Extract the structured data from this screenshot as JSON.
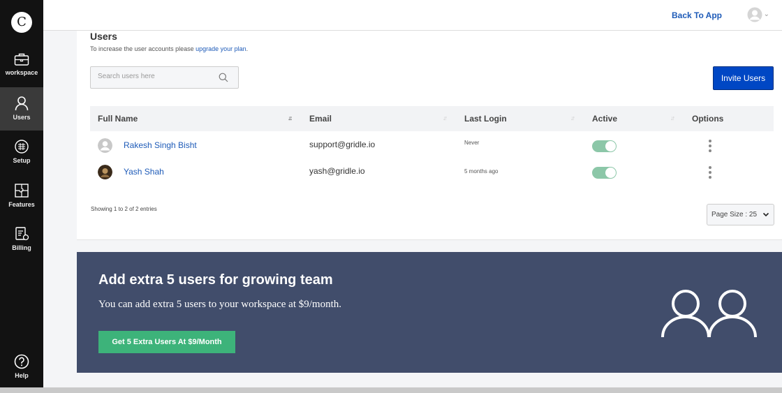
{
  "app": {
    "logo_letter": "C"
  },
  "sidebar": {
    "items": [
      {
        "label": "workspace",
        "icon": "briefcase-icon"
      },
      {
        "label": "Users",
        "icon": "user-icon",
        "active": true
      },
      {
        "label": "Setup",
        "icon": "settings-sheet-icon"
      },
      {
        "label": "Features",
        "icon": "puzzle-icon"
      },
      {
        "label": "Billing",
        "icon": "billing-icon"
      }
    ],
    "help_label": "Help"
  },
  "header": {
    "back_label": "Back To App"
  },
  "users": {
    "title": "Users",
    "subtitle_text": "To increase the user accounts please ",
    "subtitle_link": "upgrade your plan",
    "subtitle_end": ".",
    "search_placeholder": "Search users here",
    "invite_label": "Invite Users",
    "columns": [
      "Full Name",
      "Email",
      "Last Login",
      "Active",
      "Options"
    ],
    "rows": [
      {
        "name": "Rakesh Singh Bisht",
        "email": "support@gridle.io",
        "last_login": "Never",
        "active": true
      },
      {
        "name": "Yash Shah",
        "email": "yash@gridle.io",
        "last_login": "5 months ago",
        "active": true
      }
    ],
    "showing": "Showing 1 to 2 of 2 entries",
    "page_size": "Page Size : 25"
  },
  "promo": {
    "title": "Add extra 5 users for growing team",
    "text": "You can add extra 5 users to your workspace at $9/month.",
    "button": "Get 5 Extra Users At $9/Month"
  },
  "colors": {
    "primary": "#0047c4",
    "link": "#1e5bb8",
    "banner": "#414d6b",
    "cta": "#3db37a",
    "sidebar": "#121212"
  }
}
